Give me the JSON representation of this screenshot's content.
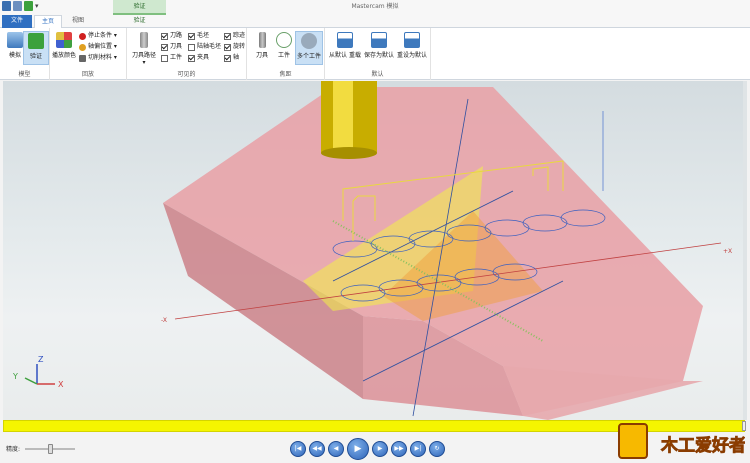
{
  "window": {
    "title": "Mastercam 模拟"
  },
  "context_tab": {
    "label": "验证"
  },
  "tabs": [
    {
      "label": "文件"
    },
    {
      "label": "主页"
    },
    {
      "label": "视图"
    },
    {
      "label": "验证"
    }
  ],
  "ribbon": {
    "groups": {
      "simulate": {
        "label": "模型",
        "buttons": [
          {
            "label": "模拟"
          },
          {
            "label": "验证"
          }
        ]
      },
      "playback": {
        "label": "回放",
        "buttons": [
          {
            "label": "播放颜色"
          },
          {
            "label": "停止条件 ▾"
          },
          {
            "label": "轴偏位置 ▾"
          },
          {
            "label": "切削材料 ▾"
          }
        ]
      },
      "visibility": {
        "label": "可见的",
        "items": [
          {
            "label": "刀具路径 ▾"
          },
          {
            "label": "刀路",
            "checked": true
          },
          {
            "label": "刀具",
            "checked": true
          },
          {
            "label": "工件",
            "checked": false
          },
          {
            "label": "毛坯",
            "checked": true
          },
          {
            "label": "陆轴毛坯",
            "checked": false
          },
          {
            "label": "夹具",
            "checked": true
          },
          {
            "label": "踪迹",
            "checked": true
          },
          {
            "label": "旋转",
            "checked": true
          },
          {
            "label": "轴",
            "checked": true
          }
        ]
      },
      "focus": {
        "label": "焦距",
        "buttons": [
          {
            "label": "刀具"
          },
          {
            "label": "工件"
          },
          {
            "label": "多个工件"
          }
        ]
      },
      "default": {
        "label": "默认",
        "buttons": [
          {
            "label": "从默认 重载"
          },
          {
            "label": "保存为默认"
          },
          {
            "label": "重设为默认"
          }
        ]
      }
    }
  },
  "viewport": {
    "axis_labels": {
      "x_pos": "+X",
      "x_neg": "-X"
    },
    "triad": {
      "x": "X",
      "y": "Y",
      "z": "Z"
    }
  },
  "bottom": {
    "speed_label": "精度:",
    "speed_value": 0.5,
    "controls": [
      "skip-to-start",
      "step-back-large",
      "step-back",
      "play",
      "step-forward",
      "step-forward-large",
      "skip-to-end",
      "loop"
    ]
  },
  "watermark": {
    "text": "木工爱好者"
  },
  "colors": {
    "accent": "#2f6fc1",
    "stock": "#e6a0a6",
    "progress": "#f5f500",
    "tool": "#d8c000"
  }
}
